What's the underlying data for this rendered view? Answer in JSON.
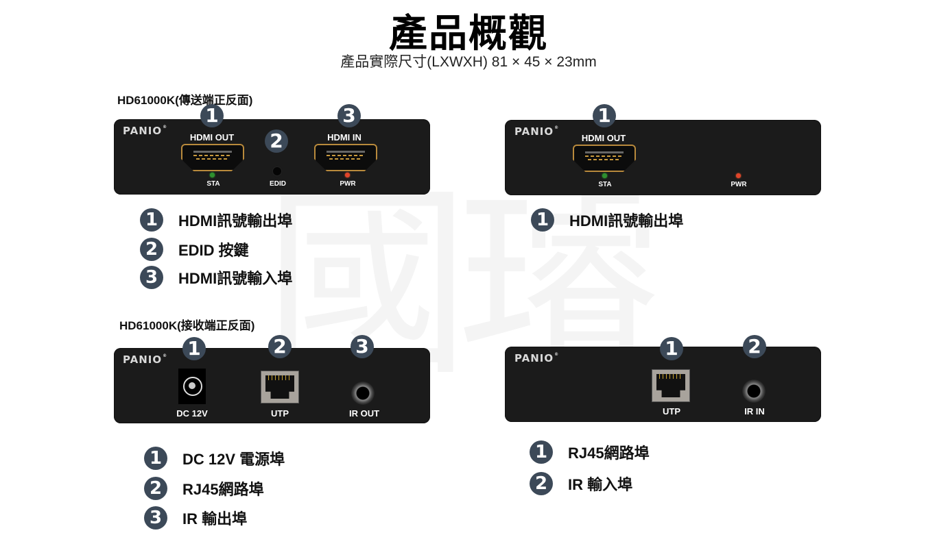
{
  "header": {
    "title": "產品概觀",
    "subtitle": "產品實際尺寸(LXWXH) 81 × 45 × 23mm"
  },
  "watermark": "國璿",
  "brand": "PANIO",
  "transmitter": {
    "section_title": "HD61000K(傳送端正反面)",
    "front": {
      "badges": [
        "1",
        "2",
        "3"
      ],
      "ports": {
        "hdmi_out": "HDMI OUT",
        "hdmi_in": "HDMI IN",
        "sta": "STA",
        "edid": "EDID",
        "pwr": "PWR"
      }
    },
    "back": {
      "badges": [
        "1"
      ],
      "ports": {
        "hdmi_out": "HDMI OUT",
        "sta": "STA",
        "pwr": "PWR"
      }
    },
    "legend_front": [
      {
        "num": "1",
        "text": "HDMI訊號輸出埠"
      },
      {
        "num": "2",
        "text": "EDID 按鍵"
      },
      {
        "num": "3",
        "text": "HDMI訊號輸入埠"
      }
    ],
    "legend_back": [
      {
        "num": "1",
        "text": "HDMI訊號輸出埠"
      }
    ]
  },
  "receiver": {
    "section_title": "HD61000K(接收端正反面)",
    "front": {
      "badges": [
        "1",
        "2",
        "3"
      ],
      "ports": {
        "dc": "DC 12V",
        "utp": "UTP",
        "ir_out": "IR OUT"
      }
    },
    "back": {
      "badges": [
        "1",
        "2"
      ],
      "ports": {
        "utp": "UTP",
        "ir_in": "IR IN"
      }
    },
    "legend_front": [
      {
        "num": "1",
        "text": "DC 12V 電源埠"
      },
      {
        "num": "2",
        "text": "RJ45網路埠"
      },
      {
        "num": "3",
        "text": "IR 輸出埠"
      }
    ],
    "legend_back": [
      {
        "num": "1",
        "text": "RJ45網路埠"
      },
      {
        "num": "2",
        "text": "IR 輸入埠"
      }
    ]
  }
}
